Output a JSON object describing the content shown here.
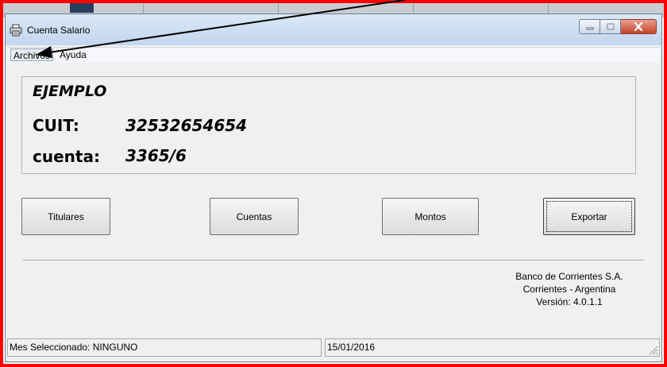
{
  "window": {
    "title": "Cuenta Salario"
  },
  "menu": {
    "items": [
      {
        "label": "Archivos"
      },
      {
        "label": "Ayuda"
      }
    ]
  },
  "info": {
    "company": "EJEMPLO",
    "cuit_label": "CUIT:",
    "cuit_value": "32532654654",
    "cuenta_label": "cuenta:",
    "cuenta_value": "3365/6"
  },
  "actions": {
    "titulares": "Titulares",
    "cuentas": "Cuentas",
    "montos": "Montos",
    "exportar": "Exportar"
  },
  "bank": {
    "name": "Banco de Corrientes S.A.",
    "location": "Corrientes - Argentina",
    "version": "Versión: 4.0.1.1"
  },
  "status": {
    "month": "Mes Seleccionado: NINGUNO",
    "date": "15/01/2016"
  },
  "colors": {
    "annotation_frame": "#ff0000",
    "arrow": "#000000"
  },
  "icons": {
    "app": "printer-icon",
    "minimize": "minimize-icon",
    "maximize": "maximize-icon",
    "close": "close-icon",
    "grip": "resize-grip-icon"
  }
}
